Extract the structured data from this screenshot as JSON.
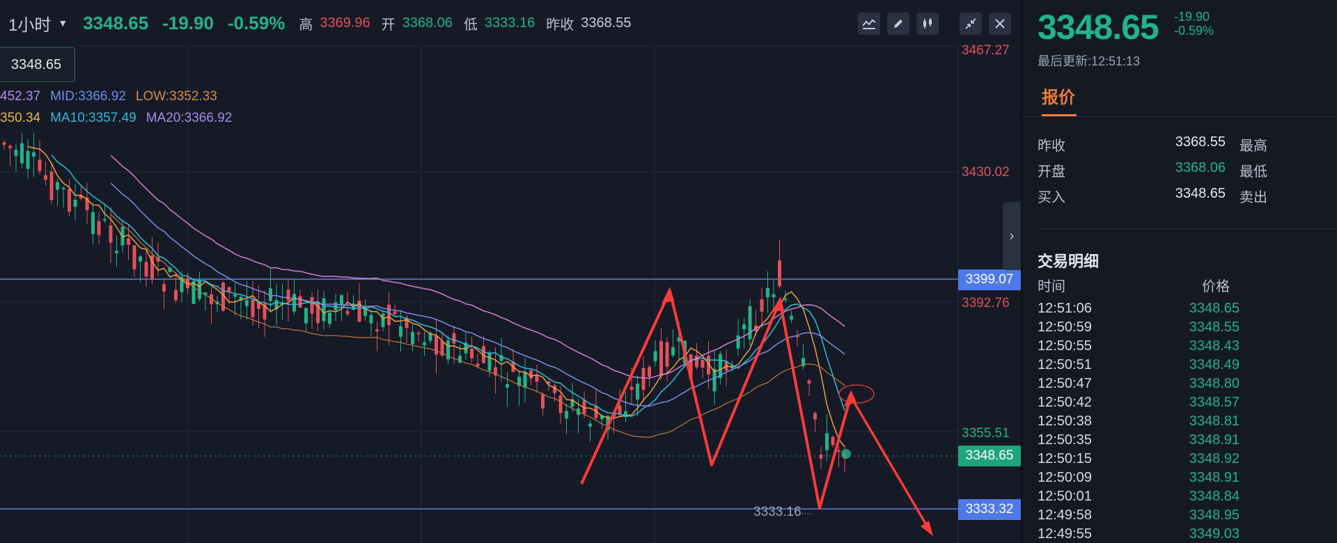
{
  "header": {
    "interval": "1小时",
    "last_price": "3348.65",
    "change": "-19.90",
    "change_pct": "-0.59%",
    "high_label": "高",
    "high_value": "3369.96",
    "open_label": "开",
    "open_value": "3368.06",
    "low_label": "低",
    "low_value": "3333.16",
    "prev_close_label": "昨收",
    "prev_close_value": "3368.55"
  },
  "tools": [
    "indicator-icon",
    "draw-pen-icon",
    "candlestick-type-icon",
    "fullscreen-collapse-icon",
    "close-icon"
  ],
  "chart": {
    "price_tag": "3348.65",
    "legend_boll": {
      "up": "452.37",
      "mid": "MID:3366.92",
      "low": "LOW:3352.33"
    },
    "legend_ma": {
      "ma5": "350.34",
      "ma10": "MA10:3357.49",
      "ma20": "MA20:3366.92"
    },
    "axis_labels": [
      "3467.27",
      "3430.02",
      "3392.76",
      "3355.51"
    ],
    "resistance_level": "3399.07",
    "current_level": "3348.65",
    "support_level": "3333.32",
    "low_marker": "3333.16",
    "colors": {
      "up": "#22b38a",
      "down": "#e3505a",
      "boll_upper": "#d67ed4",
      "boll_mid": "#7f8ce8",
      "ma5": "#f0a340",
      "ma10": "#31bfd9",
      "annotation": "#ff3b3b",
      "level_line": "#5b7fe0"
    }
  },
  "side": {
    "price": "3348.65",
    "change": "-19.90",
    "change_pct": "-0.59%",
    "updated": "最后更新:12:51:13",
    "tab": "报价",
    "quote_rows": [
      {
        "label": "昨收",
        "value": "3368.55",
        "label2": "最高"
      },
      {
        "label": "开盘",
        "value": "3368.06",
        "label2": "最低"
      },
      {
        "label": "买入",
        "value": "3348.65",
        "label2": "卖出"
      }
    ],
    "trades_title": "交易明细",
    "col_time": "时间",
    "col_price": "价格",
    "trades": [
      {
        "time": "12:51:06",
        "price": "3348.65"
      },
      {
        "time": "12:50:59",
        "price": "3348.55"
      },
      {
        "time": "12:50:55",
        "price": "3348.43"
      },
      {
        "time": "12:50:51",
        "price": "3348.49"
      },
      {
        "time": "12:50:47",
        "price": "3348.80"
      },
      {
        "time": "12:50:42",
        "price": "3348.57"
      },
      {
        "time": "12:50:38",
        "price": "3348.81"
      },
      {
        "time": "12:50:35",
        "price": "3348.91"
      },
      {
        "time": "12:50:15",
        "price": "3348.92"
      },
      {
        "time": "12:50:09",
        "price": "3348.91"
      },
      {
        "time": "12:50:01",
        "price": "3348.84"
      },
      {
        "time": "12:49:58",
        "price": "3348.95"
      },
      {
        "time": "12:49:55",
        "price": "3349.03"
      }
    ]
  }
}
